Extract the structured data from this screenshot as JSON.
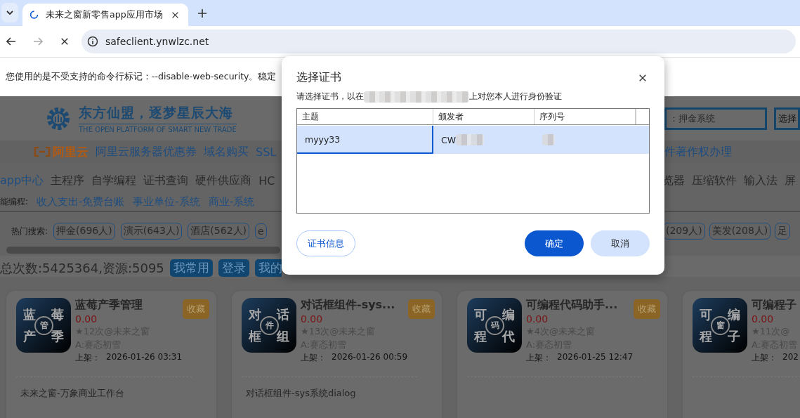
{
  "browser": {
    "tabs": [
      {
        "title": "未来之窗新零售app应用市场",
        "selected": true,
        "loading": true
      }
    ],
    "url": "safeclient.ynwlzc.net",
    "infobar": "您使用的是不受支持的命令行标记：--disable-web-security。稳定"
  },
  "page": {
    "header": {
      "slogan": "东方仙盟，逐梦星辰大海",
      "tagline": "THE OPEN PLATFORM OF SMART NEW TRADE",
      "search_placeholder": "：押金系统",
      "search_button": "选择"
    },
    "ads": {
      "logo": "阿里云",
      "left": [
        "阿里云服务器优惠券",
        "域名购买",
        "SSL"
      ],
      "right": [
        "件著作权办理"
      ]
    },
    "nav": {
      "left": [
        {
          "label": "app中心",
          "selected": true
        },
        {
          "label": "主程序",
          "selected": false
        },
        {
          "label": "自学编程",
          "selected": false
        },
        {
          "label": "证书查询",
          "selected": false
        },
        {
          "label": "硬件供应商",
          "selected": false
        },
        {
          "label": "HC",
          "selected": false
        }
      ],
      "right": [
        {
          "label": "览器",
          "selected": false
        },
        {
          "label": "压缩软件",
          "selected": false
        },
        {
          "label": "输入法",
          "selected": false
        },
        {
          "label": "屏",
          "selected": false
        }
      ]
    },
    "smart": {
      "label": "能编程:",
      "links": [
        "收入支出-免费台账",
        "事业单位-系统",
        "商业-系统"
      ]
    },
    "hot": {
      "label": "热门搜索:",
      "left": [
        "押金(696人)",
        "演示(643人)",
        "酒店(562人)",
        "e"
      ],
      "right": [
        "(209人)",
        "美发(208人)",
        "足"
      ]
    },
    "stats": {
      "text": "总次数:5425364,资源:5095",
      "buttons": [
        "我常用",
        "登录",
        "我的"
      ]
    },
    "cards": [
      {
        "icon_chars": [
          "蓝",
          "莓",
          "产",
          "季"
        ],
        "icon_center": "管",
        "title": "蓝莓产季管理",
        "price": "0.00",
        "stats": "★12次@未来之窗",
        "author": "A:赛忞初雪",
        "date_label": "上架：",
        "date": "2026-01-26 03:31",
        "favorite": "收藏",
        "description": "未来之窗-万象商业工作台"
      },
      {
        "icon_chars": [
          "对",
          "话",
          "框",
          "组"
        ],
        "icon_center": "件",
        "title": "对话框组件-sys...",
        "price": "0.00",
        "stats": "★13次@未来之窗",
        "author": "A:赛忞初雪",
        "date_label": "上架：",
        "date": "2026-01-26 00:59",
        "favorite": "收藏",
        "description": "对话框组件-sys系统dialog"
      },
      {
        "icon_chars": [
          "可",
          "编",
          "程",
          "代"
        ],
        "icon_center": "码",
        "title": "可编程代码助手...",
        "price": "0.00",
        "stats": "★4次@未来之窗",
        "author": "A:赛忞初雪",
        "date_label": "上架：",
        "date": "2026-01-25 12:47",
        "favorite": "收藏"
      },
      {
        "icon_chars": [
          "可",
          "编",
          "程",
          "子"
        ],
        "icon_center": "窗",
        "title": "可编程子",
        "price": "0.00",
        "stats": "★11次@",
        "author": "A:赛忞初雪",
        "date_label": "上架：",
        "date": "202"
      }
    ]
  },
  "dialog": {
    "title": "选择证书",
    "subtitle_before": "请选择证书，以在",
    "subtitle_after": "上对您本人进行身份验证",
    "columns": [
      "主题",
      "颁发者",
      "序列号"
    ],
    "rows": [
      {
        "selected": true,
        "cells": [
          {
            "text": "myyy33",
            "redacted": false
          },
          {
            "text": "CW",
            "redacted": true
          },
          {
            "redacted": true
          }
        ]
      }
    ],
    "buttons": [
      {
        "label": "证书信息",
        "kind": "outline"
      },
      {
        "label": "确定",
        "kind": "primary"
      },
      {
        "label": "取消",
        "kind": "secondary"
      }
    ]
  }
}
